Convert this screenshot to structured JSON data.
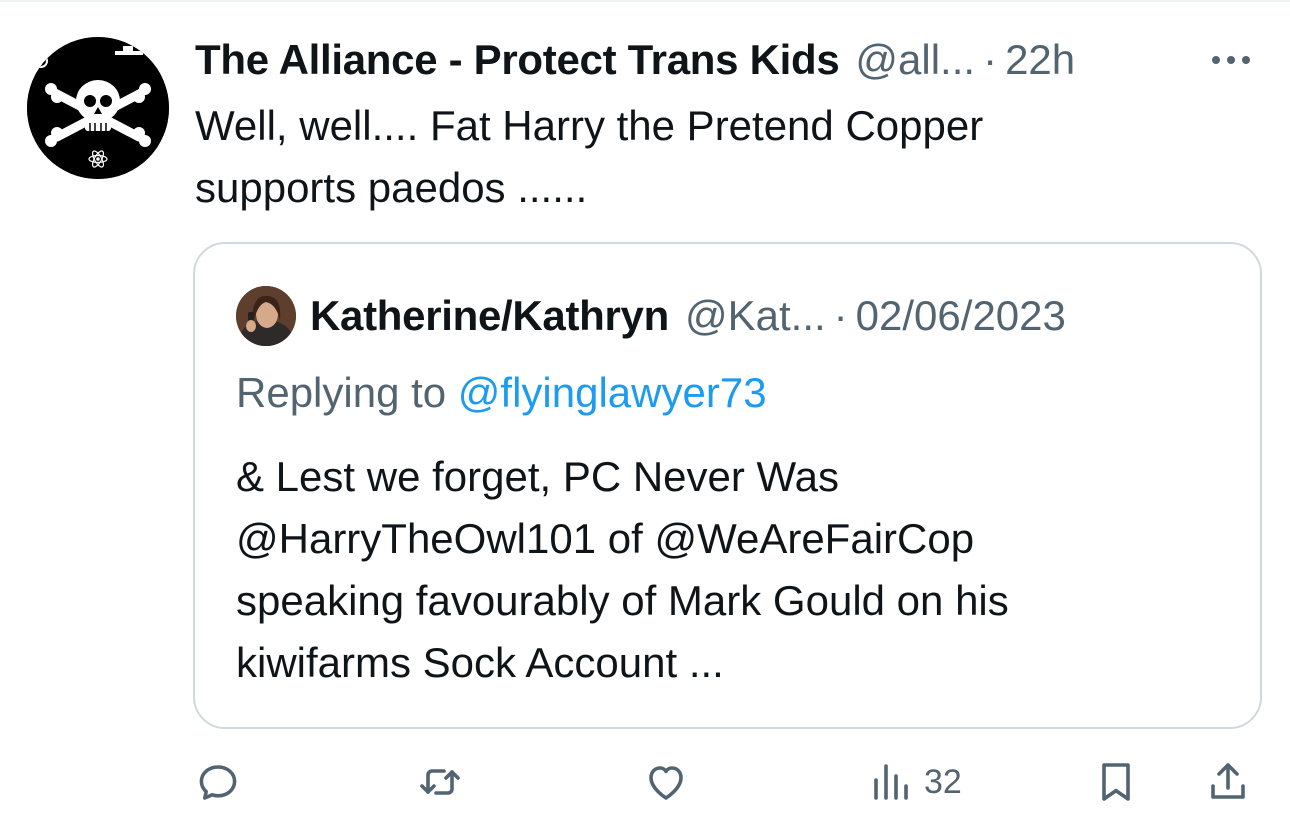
{
  "tweet": {
    "display_name": "The Alliance - Protect Trans Kids",
    "handle": "@all...",
    "separator": "·",
    "time": "22h",
    "text_line1": "Well, well....  Fat Harry the Pretend Copper",
    "text_line2": "supports paedos ......",
    "avatar_icon": "jolly-roger-skull-icon"
  },
  "quote": {
    "display_name": "Katherine/Kathryn",
    "handle": "@Kat...",
    "separator": "·",
    "time": "02/06/2023",
    "replying_prefix": "Replying to",
    "replying_mention": "@flyinglawyer73",
    "text_lines": [
      "& Lest we forget, PC Never Was",
      "@HarryTheOwl101 of @WeAreFairCop",
      "speaking favourably of Mark Gould on his",
      "kiwifarms Sock Account ..."
    ]
  },
  "actions": {
    "views_count": "32",
    "icons": [
      "reply-icon",
      "retweet-icon",
      "like-icon",
      "views-icon",
      "bookmark-icon",
      "share-icon"
    ]
  },
  "colors": {
    "text": "#0f1419",
    "secondary": "#536471",
    "link": "#1d9bf0",
    "border": "#cfd9de"
  }
}
